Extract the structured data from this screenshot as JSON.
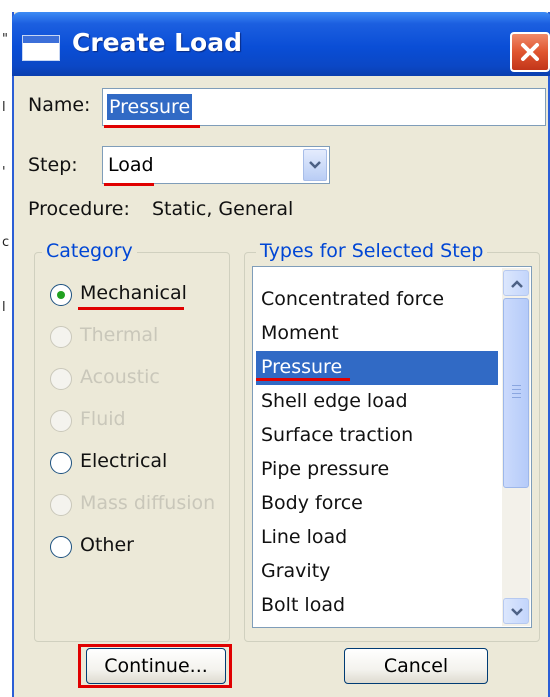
{
  "window": {
    "title": "Create Load"
  },
  "form": {
    "name_label": "Name:",
    "name_value": "Pressure",
    "step_label": "Step:",
    "step_value": "Load",
    "procedure_label": "Procedure:",
    "procedure_value": "Static, General"
  },
  "category": {
    "title": "Category",
    "options": [
      {
        "label": "Mechanical",
        "selected": true,
        "enabled": true
      },
      {
        "label": "Thermal",
        "selected": false,
        "enabled": false
      },
      {
        "label": "Acoustic",
        "selected": false,
        "enabled": false
      },
      {
        "label": "Fluid",
        "selected": false,
        "enabled": false
      },
      {
        "label": "Electrical",
        "selected": false,
        "enabled": true
      },
      {
        "label": "Mass diffusion",
        "selected": false,
        "enabled": false
      },
      {
        "label": "Other",
        "selected": false,
        "enabled": true
      }
    ]
  },
  "types": {
    "title": "Types for Selected Step",
    "items": [
      "Concentrated force",
      "Moment",
      "Pressure",
      "Shell edge load",
      "Surface traction",
      "Pipe pressure",
      "Body force",
      "Line load",
      "Gravity",
      "Bolt load"
    ],
    "selected": "Pressure"
  },
  "buttons": {
    "continue": "Continue...",
    "cancel": "Cancel"
  },
  "colors": {
    "title_bar": "#0a4ed6",
    "dialog_bg": "#ece9d8",
    "group_title": "#0046d5",
    "selection": "#316ac5",
    "annotation_red": "#e00000",
    "radio_dot": "#21a121"
  },
  "icons": {
    "window_icon": "window-icon",
    "close": "close-icon",
    "combo_arrow": "chevron-down-icon",
    "scroll_up": "scroll-up-icon",
    "scroll_down": "scroll-down-icon"
  }
}
